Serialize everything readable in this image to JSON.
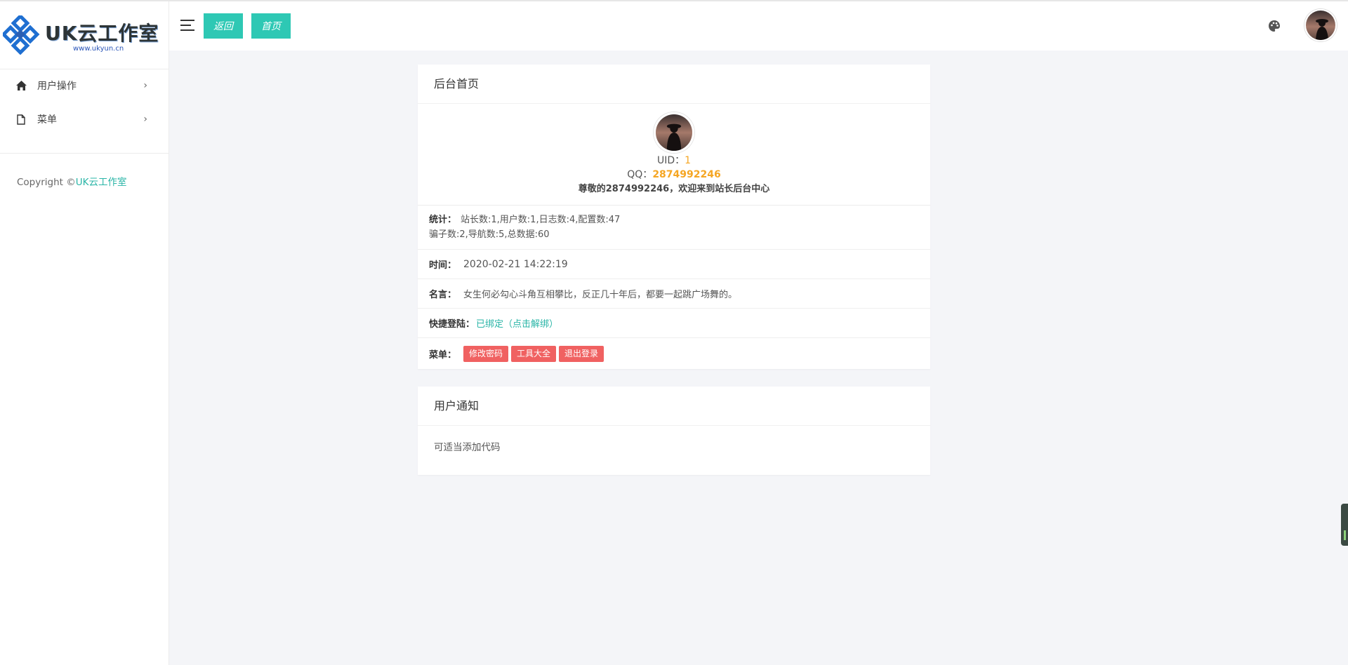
{
  "sidebar": {
    "logo": {
      "text": "UK云工作室",
      "url": "www.ukyun.cn"
    },
    "items": [
      {
        "label": "用户操作",
        "icon": "home-icon"
      },
      {
        "label": "菜单",
        "icon": "file-icon"
      }
    ],
    "copyright_prefix": "Copyright ©",
    "copyright_link": "UK云工作室"
  },
  "header": {
    "back_label": "返回",
    "home_label": "首页",
    "accent_color": "#2ec8b4"
  },
  "home_card": {
    "title": "后台首页",
    "uid_label": "UID：",
    "uid": "1",
    "qq_label": "QQ：",
    "qq": "2874992246",
    "welcome": "尊敬的2874992246，欢迎来到站长后台中心",
    "stats_label": "统计：",
    "stats_line1": "站长数:1,用户数:1,日志数:4,配置数:47",
    "stats_line2": "骗子数:2,导航数:5,总数据:60",
    "time_label": "时间：",
    "time": "2020-02-21 14:22:19",
    "quote_label": "名言：",
    "quote": "女生何必勾心斗角互相攀比，反正几十年后，都要一起跳广场舞的。",
    "quick_login_label": "快捷登陆：",
    "quick_login_value": "已绑定（点击解绑）",
    "menu_label": "菜单：",
    "menu_buttons": [
      "修改密码",
      "工具大全",
      "退出登录"
    ]
  },
  "notice_card": {
    "title": "用户通知",
    "body": "可适当添加代码"
  }
}
